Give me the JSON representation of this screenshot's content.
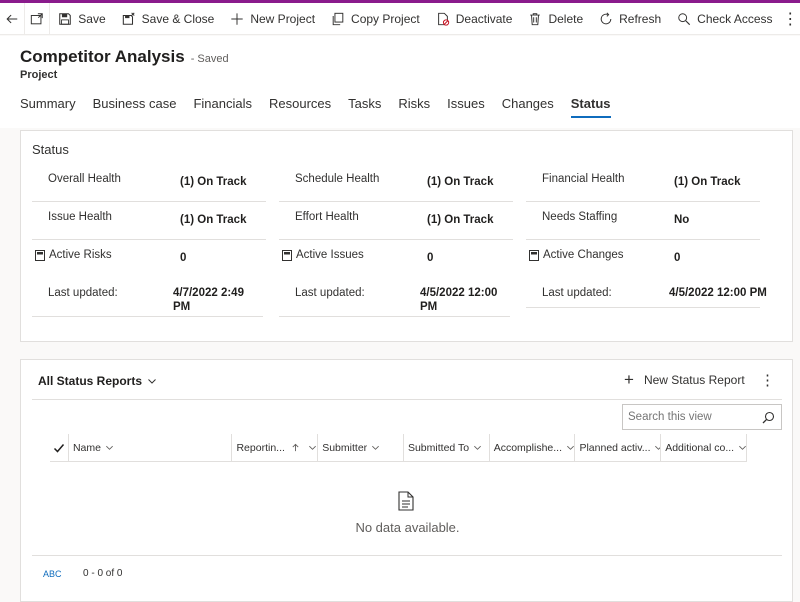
{
  "toolbar": {
    "save": "Save",
    "save_close": "Save & Close",
    "new_project": "New Project",
    "copy_project": "Copy Project",
    "deactivate": "Deactivate",
    "delete": "Delete",
    "refresh": "Refresh",
    "check_access": "Check Access",
    "more": "⋮"
  },
  "header": {
    "title": "Competitor Analysis",
    "saved_status": "- Saved",
    "entity": "Project"
  },
  "tabs": [
    "Summary",
    "Business case",
    "Financials",
    "Resources",
    "Tasks",
    "Risks",
    "Issues",
    "Changes",
    "Status"
  ],
  "active_tab": "Status",
  "status_section": {
    "title": "Status",
    "columns": [
      {
        "rows": [
          {
            "label": "Overall Health",
            "value": "(1) On Track"
          },
          {
            "label": "Issue Health",
            "value": "(1) On Track"
          },
          {
            "label": "Active Risks",
            "value": "0"
          }
        ],
        "updated_label": "Last updated:",
        "updated_value": "4/7/2022 2:49 PM"
      },
      {
        "rows": [
          {
            "label": "Schedule Health",
            "value": "(1) On Track"
          },
          {
            "label": "Effort Health",
            "value": "(1) On Track"
          },
          {
            "label": "Active Issues",
            "value": "0"
          }
        ],
        "updated_label": "Last updated:",
        "updated_value": "4/5/2022 12:00 PM"
      },
      {
        "rows": [
          {
            "label": "Financial Health",
            "value": "(1) On Track"
          },
          {
            "label": "Needs Staffing",
            "value": "No"
          },
          {
            "label": "Active Changes",
            "value": "0"
          }
        ],
        "updated_label": "Last updated:",
        "updated_value": "4/5/2022 12:00 PM"
      }
    ]
  },
  "reports": {
    "view_name": "All Status Reports",
    "new_button": "New Status Report",
    "search_placeholder": "Search this view",
    "columns": [
      "Name",
      "Reportin...",
      "Submitter",
      "Submitted To",
      "Accomplishe...",
      "Planned activ...",
      "Additional co..."
    ],
    "empty_message": "No data available.",
    "footer_letters": "ABC",
    "record_count": "0 - 0 of 0"
  },
  "colors": {
    "accent": "#0f6cbd",
    "brand_bar": "#8a1b8c",
    "text": "#323130",
    "border": "#e1dfdd"
  }
}
